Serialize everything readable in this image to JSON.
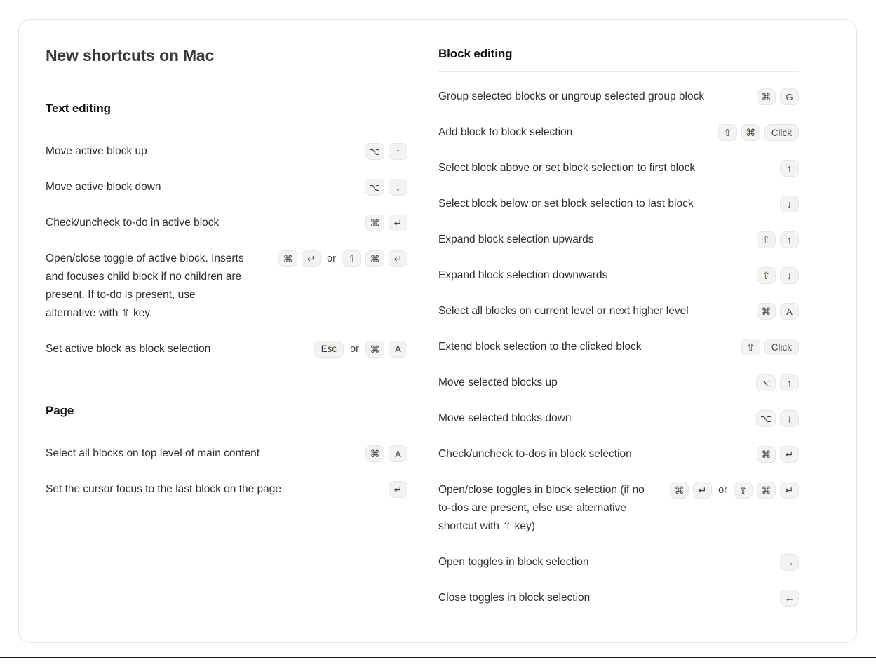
{
  "card": {
    "title": "New shortcuts on Mac"
  },
  "glyphs": {
    "command": "⌘",
    "option": "⌥",
    "shift": "⇧",
    "return": "↵",
    "arrow_up": "↑",
    "arrow_down": "↓",
    "arrow_right": "→",
    "arrow_left": "←"
  },
  "separator_or": "or",
  "left_column": {
    "sections": [
      {
        "title": "Text editing",
        "rows": [
          {
            "label": "Move active block up",
            "keys": [
              "⌥",
              "↑"
            ]
          },
          {
            "label": "Move active block down",
            "keys": [
              "⌥",
              "↓"
            ]
          },
          {
            "label": "Check/uncheck to-do in active block",
            "keys": [
              "⌘",
              "↵"
            ]
          },
          {
            "label": "Open/close toggle of active block. Inserts and focuses child block if no children are present. If to-do is present, use alternative with ⇧ key.",
            "keys": [
              "⌘",
              "↵",
              "or",
              "⇧",
              "⌘",
              "↵"
            ]
          },
          {
            "label": "Set active block as block selection",
            "keys": [
              "Esc",
              "or",
              "⌘",
              "A"
            ]
          }
        ]
      },
      {
        "title": "Page",
        "rows": [
          {
            "label": "Select all blocks on top level of main content",
            "keys": [
              "⌘",
              "A"
            ]
          },
          {
            "label": "Set the cursor focus to the last block on the page",
            "keys": [
              "↵"
            ]
          }
        ]
      }
    ]
  },
  "right_column": {
    "sections": [
      {
        "title": "Block editing",
        "rows": [
          {
            "label": "Group selected blocks or ungroup selected group block",
            "keys": [
              "⌘",
              "G"
            ]
          },
          {
            "label": "Add block to block selection",
            "keys": [
              "⇧",
              "⌘",
              "Click"
            ]
          },
          {
            "label": "Select block above or set block selection to first block",
            "keys": [
              "↑"
            ]
          },
          {
            "label": "Select block below or set block selection to last block",
            "keys": [
              "↓"
            ]
          },
          {
            "label": "Expand block selection upwards",
            "keys": [
              "⇧",
              "↑"
            ]
          },
          {
            "label": "Expand block selection downwards",
            "keys": [
              "⇧",
              "↓"
            ]
          },
          {
            "label": "Select all blocks on current level or next higher level",
            "keys": [
              "⌘",
              "A"
            ]
          },
          {
            "label": "Extend block selection to the clicked block",
            "keys": [
              "⇧",
              "Click"
            ]
          },
          {
            "label": "Move selected blocks up",
            "keys": [
              "⌥",
              "↑"
            ]
          },
          {
            "label": "Move selected blocks down",
            "keys": [
              "⌥",
              "↓"
            ]
          },
          {
            "label": "Check/uncheck to-dos in block selection",
            "keys": [
              "⌘",
              "↵"
            ]
          },
          {
            "label": "Open/close toggles in block selection (if no to-dos are present, else use alternative shortcut with ⇧ key)",
            "keys": [
              "⌘",
              "↵",
              "or",
              "⇧",
              "⌘",
              "↵"
            ]
          },
          {
            "label": "Open toggles in block selection",
            "keys": [
              "→"
            ]
          },
          {
            "label": "Close toggles in block selection",
            "keys": [
              "←"
            ]
          }
        ]
      }
    ]
  },
  "colors": {
    "card_border": "#e6e3df",
    "rule": "#eceae7",
    "key_bg": "#f4f3f1",
    "key_border": "#e8e6e3",
    "text": "#2f2f2f",
    "title": "#3b3a36",
    "bottom_rule": "#161616"
  }
}
